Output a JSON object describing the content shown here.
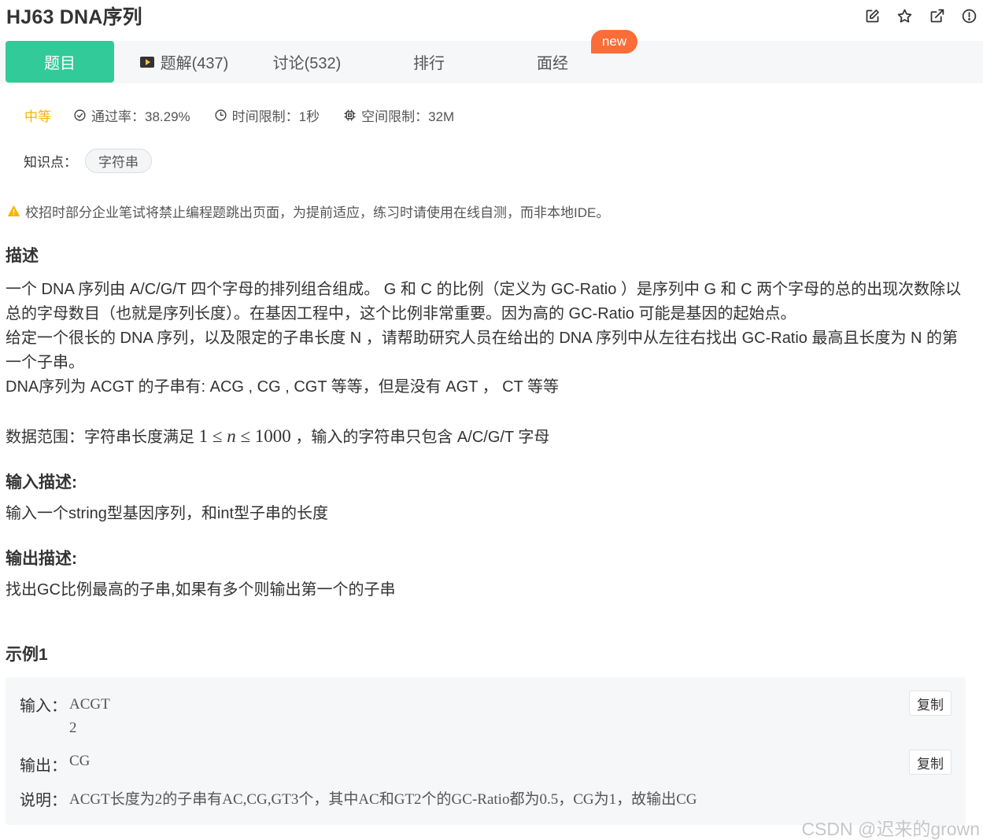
{
  "problem": {
    "title": "HJ63  DNA序列"
  },
  "toolbar_icons": [
    "edit-icon",
    "star-icon",
    "external-link-icon",
    "info-icon"
  ],
  "tabs": {
    "problem": "题目",
    "solutions": "题解(437)",
    "discussion": "讨论(532)",
    "ranking": "排行",
    "interview": "面经",
    "new_badge": "new"
  },
  "meta": {
    "difficulty": "中等",
    "pass_rate": "通过率：38.29%",
    "time_limit": "时间限制：1秒",
    "space_limit": "空间限制：32M"
  },
  "knowledge": {
    "label": "知识点：",
    "tag": "字符串"
  },
  "warning": "校招时部分企业笔试将禁止编程题跳出页面，为提前适应，练习时请使用在线自测，而非本地IDE。",
  "description": {
    "heading": "描述",
    "p1": "一个 DNA 序列由 A/C/G/T 四个字母的排列组合组成。 G 和 C 的比例（定义为 GC-Ratio ）是序列中 G 和 C 两个字母的总的出现次数除以总的字母数目（也就是序列长度）。在基因工程中，这个比例非常重要。因为高的 GC-Ratio 可能是基因的起始点。",
    "p2": "给定一个很长的 DNA 序列，以及限定的子串长度 N ，请帮助研究人员在给出的 DNA 序列中从左往右找出 GC-Ratio 最高且长度为 N 的第一个子串。",
    "p3": "DNA序列为 ACGT 的子串有: ACG , CG , CGT 等等，但是没有 AGT ，  CT 等等",
    "range_prefix": "数据范围：字符串长度满足 ",
    "range_math_1": "1 ≤ ",
    "range_math_n": "n",
    "range_math_2": " ≤ 1000",
    "range_suffix": " ，输入的字符串只包含 A/C/G/T 字母"
  },
  "input_desc": {
    "heading": "输入描述:",
    "text": "输入一个string型基因序列，和int型子串的长度"
  },
  "output_desc": {
    "heading": "输出描述:",
    "text": "找出GC比例最高的子串,如果有多个则输出第一个的子串"
  },
  "example": {
    "heading": "示例1",
    "input_label": "输入：",
    "input_line1": "ACGT",
    "input_line2": "2",
    "output_label": "输出：",
    "output_value": "CG",
    "explain_label": "说明：",
    "explain_value": "ACGT长度为2的子串有AC,CG,GT3个，其中AC和GT2个的GC-Ratio都为0.5，CG为1，故输出CG",
    "copy_label": "复制"
  },
  "watermark": "CSDN @迟来的grown"
}
